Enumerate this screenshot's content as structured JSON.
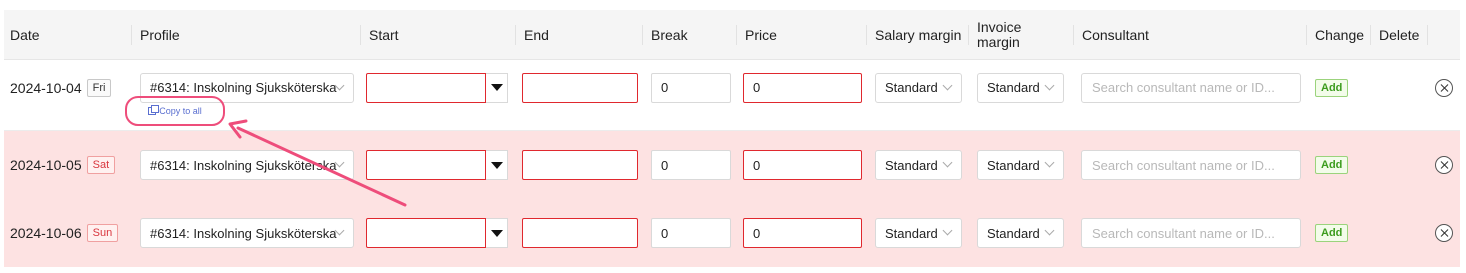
{
  "headers": {
    "date": "Date",
    "profile": "Profile",
    "start": "Start",
    "end": "End",
    "break": "Break",
    "price": "Price",
    "salary_margin": "Salary margin",
    "invoice_margin_line1": "Invoice",
    "invoice_margin_line2": "margin",
    "consultant": "Consultant",
    "change": "Change",
    "delete": "Delete"
  },
  "rows": [
    {
      "date": "2024-10-04",
      "day": "Fri",
      "profile": "#6314: Inskolning Sjuksköterska",
      "break": "0",
      "price": "0",
      "salary_margin": "Standard",
      "invoice_margin": "Standard",
      "consultant_placeholder": "Search consultant name or ID...",
      "change_label": "Add"
    },
    {
      "date": "2024-10-05",
      "day": "Sat",
      "profile": "#6314: Inskolning Sjuksköterska",
      "break": "0",
      "price": "0",
      "salary_margin": "Standard",
      "invoice_margin": "Standard",
      "consultant_placeholder": "Search consultant name or ID...",
      "change_label": "Add"
    },
    {
      "date": "2024-10-06",
      "day": "Sun",
      "profile": "#6314: Inskolning Sjuksköterska",
      "break": "0",
      "price": "0",
      "salary_margin": "Standard",
      "invoice_margin": "Standard",
      "consultant_placeholder": "Search consultant name or ID...",
      "change_label": "Add"
    }
  ],
  "copy_to_all": "Copy to all",
  "colors": {
    "weekend_row": "#fde2e2",
    "error_border": "#e0282e",
    "annotation": "#ee4d7b",
    "add_green": "#3c9c1e",
    "link_blue": "#5a6fd0"
  }
}
